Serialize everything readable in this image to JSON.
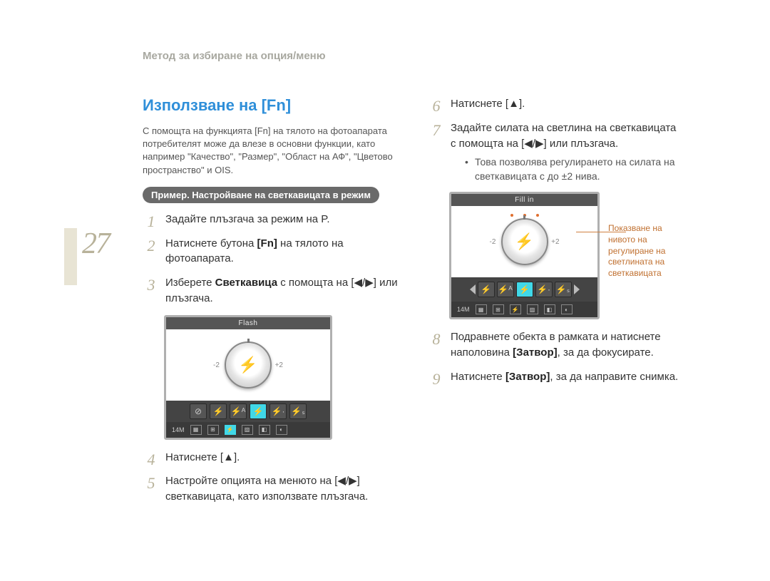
{
  "header": "Метод за избиране на опция/меню",
  "page_number": "27",
  "section_title": "Използване на [Fn]",
  "intro": "С помощта на функцията [Fn] на тялото на фотоапарата потребителят може да влезе в основни функции, като например \"Качество\", \"Размер\", \"Област на АФ\", \"Цветово пространство\" и OIS.",
  "example_label": "Пример.   Настройване на светкавицата в режим",
  "steps_left": {
    "s1": "Задайте плъзгача за режим на P.",
    "s2_a": "Натиснете бутона ",
    "s2_b": "[Fn]",
    "s2_c": " на тялото на фотоапарата.",
    "s3_a": "Изберете ",
    "s3_b": "Светкавица",
    "s3_c": " с помощта на [◀/▶] или плъзгача.",
    "s4": "Натиснете [▲].",
    "s5": "Настройте опцията на менюто на [◀/▶] светкавицата, като използвате плъзгача."
  },
  "steps_right": {
    "s6": "Натиснете [▲].",
    "s7": "Задайте силата на светлина на светкавицата с помощта на [◀/▶] или плъзгача.",
    "s7_bullet": "Това позволява регулирането на силата на светкавицата с до ±2 нива.",
    "s8_a": "Подравнете обекта в рамката и натиснете наполовина ",
    "s8_b": "[Затвор]",
    "s8_c": ", за да фокусирате.",
    "s9_a": "Натиснете ",
    "s9_b": "[Затвор]",
    "s9_c": ", за да направите снимка."
  },
  "lcd1": {
    "title": "Flash",
    "footer_14m": "14M",
    "center_icon": "⚡",
    "dial_minus": "-2",
    "dial_plus": "+2"
  },
  "lcd2": {
    "title": "Fill in",
    "footer_14m": "14M",
    "center_icon": "⚡",
    "dial_minus": "-2",
    "dial_plus": "+2"
  },
  "annotation": "Показване на нивото на регулиране на светлината на светкавицата"
}
